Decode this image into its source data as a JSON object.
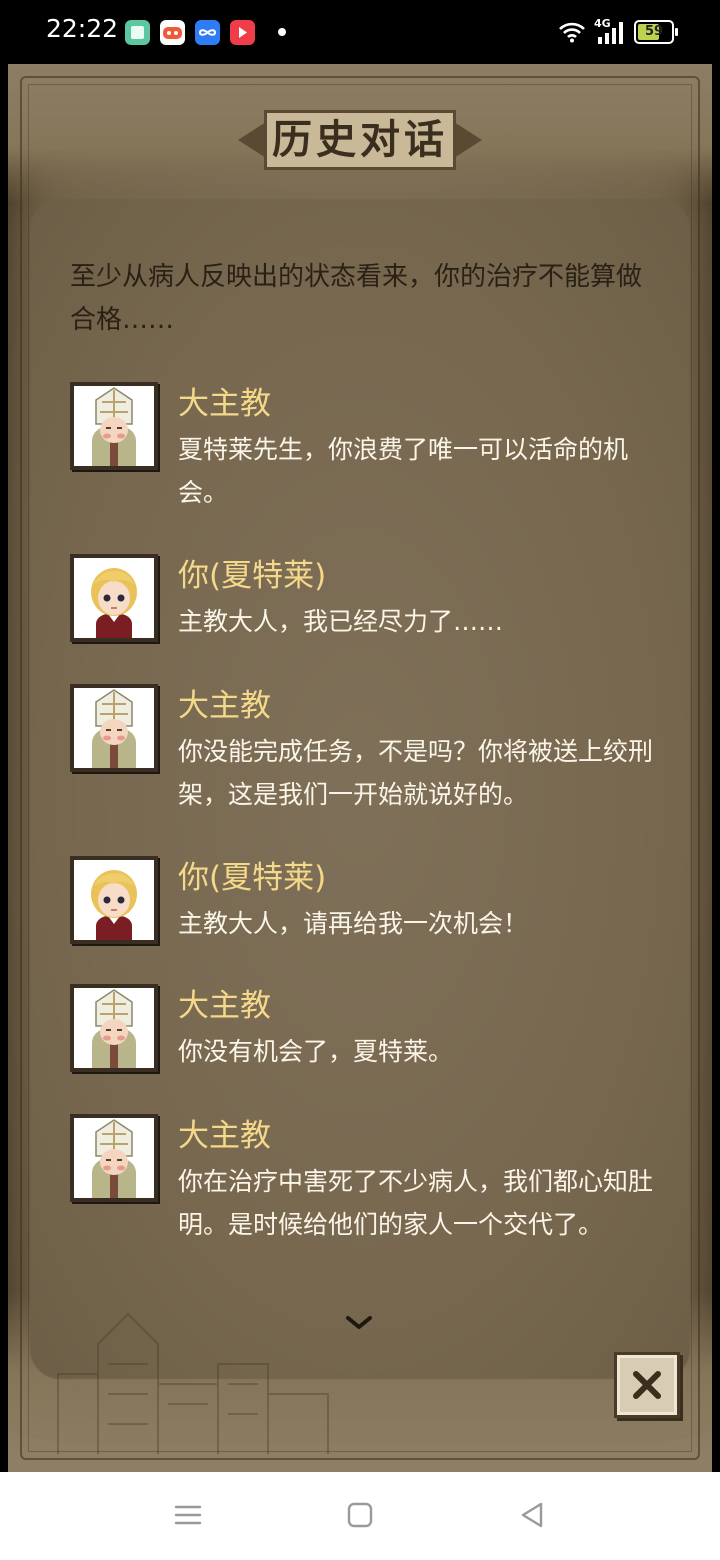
{
  "status_bar": {
    "time": "22:22",
    "battery": "59",
    "network": "4G"
  },
  "dialog": {
    "title": "历史对话",
    "intro": "至少从病人反映出的状态看来，你的治疗不能算做合格……",
    "entries": [
      {
        "speaker": "大主教",
        "text": "夏特莱先生，你浪费了唯一可以活命的机会。",
        "portrait": "archbishop-portrait"
      },
      {
        "speaker": "你(夏特莱)",
        "text": "主教大人，我已经尽力了……",
        "portrait": "chatelet-portrait"
      },
      {
        "speaker": "大主教",
        "text": "你没能完成任务，不是吗？你将被送上绞刑架，这是我们一开始就说好的。",
        "portrait": "archbishop-portrait"
      },
      {
        "speaker": "你(夏特莱)",
        "text": "主教大人，请再给我一次机会！",
        "portrait": "chatelet-portrait"
      },
      {
        "speaker": "大主教",
        "text": "你没有机会了，夏特莱。",
        "portrait": "archbishop-portrait"
      },
      {
        "speaker": "大主教",
        "text": "你在治疗中害死了不少病人，我们都心知肚明。是时候给他们的家人一个交代了。",
        "portrait": "archbishop-portrait"
      }
    ]
  },
  "colors": {
    "speaker": "#f5d98a",
    "dialog_text": "#fbf5e8",
    "intro_text": "#2a2116",
    "panel": "#786850"
  },
  "icons": {
    "scroll_more": "chevron-down-icon",
    "close": "close-icon",
    "nav_menu": "menu-icon",
    "nav_home": "home-icon",
    "nav_back": "back-icon"
  }
}
